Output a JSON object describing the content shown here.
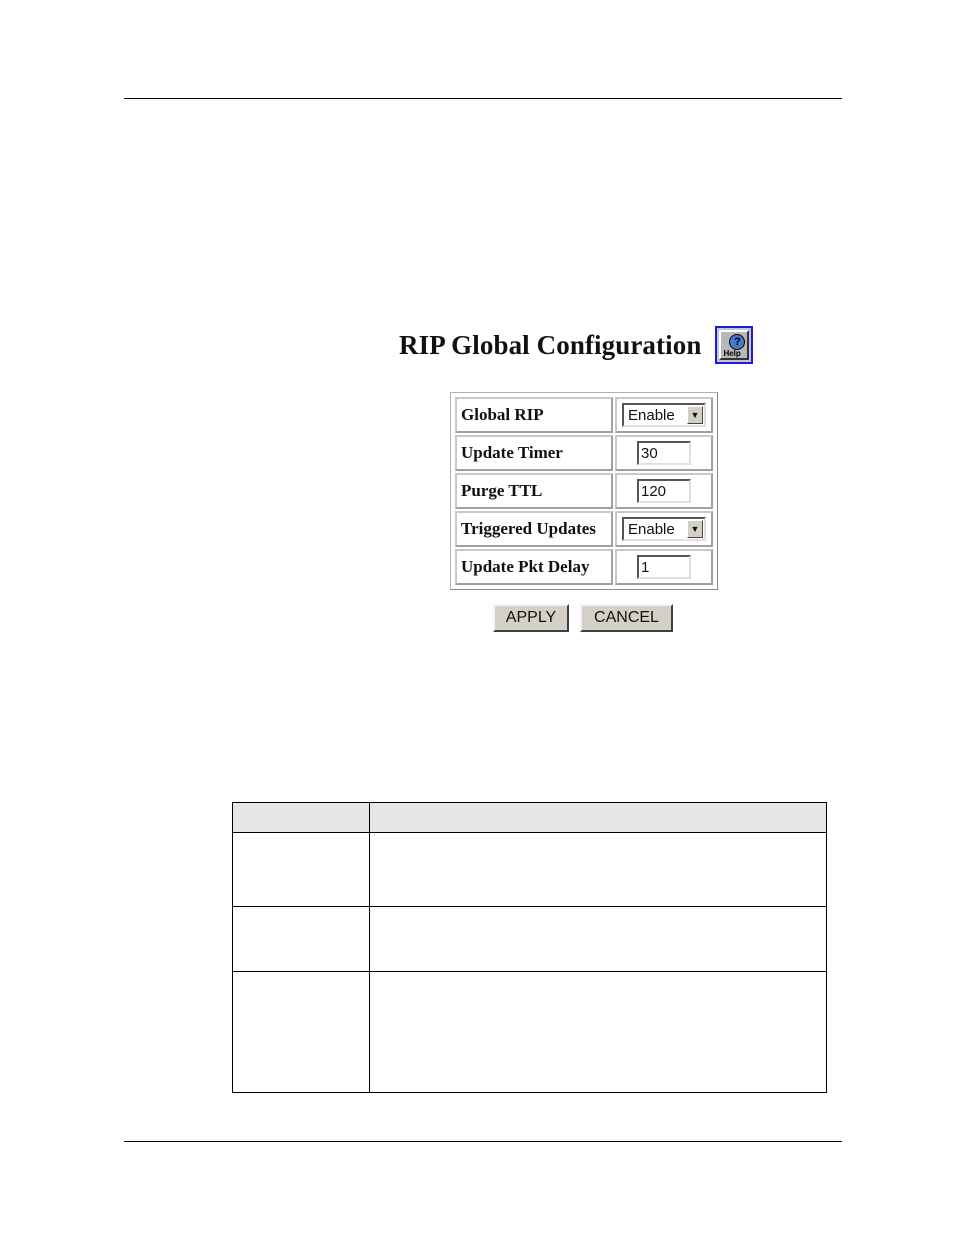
{
  "page": {
    "title": "RIP Global Configuration",
    "help_button": {
      "icon": "help-icon",
      "label": "Help"
    }
  },
  "config": {
    "rows": [
      {
        "label": "Global RIP",
        "type": "select",
        "value": "Enable"
      },
      {
        "label": "Update Timer",
        "type": "text",
        "value": "30"
      },
      {
        "label": "Purge TTL",
        "type": "text",
        "value": "120"
      },
      {
        "label": "Triggered Updates",
        "type": "select",
        "value": "Enable"
      },
      {
        "label": "Update Pkt Delay",
        "type": "text",
        "value": "1"
      }
    ]
  },
  "actions": {
    "apply_label": "APPLY",
    "cancel_label": "CANCEL"
  },
  "description_table": {
    "headers": [
      "",
      ""
    ],
    "rows": [
      [
        "",
        ""
      ],
      [
        "",
        ""
      ],
      [
        "",
        ""
      ]
    ]
  }
}
